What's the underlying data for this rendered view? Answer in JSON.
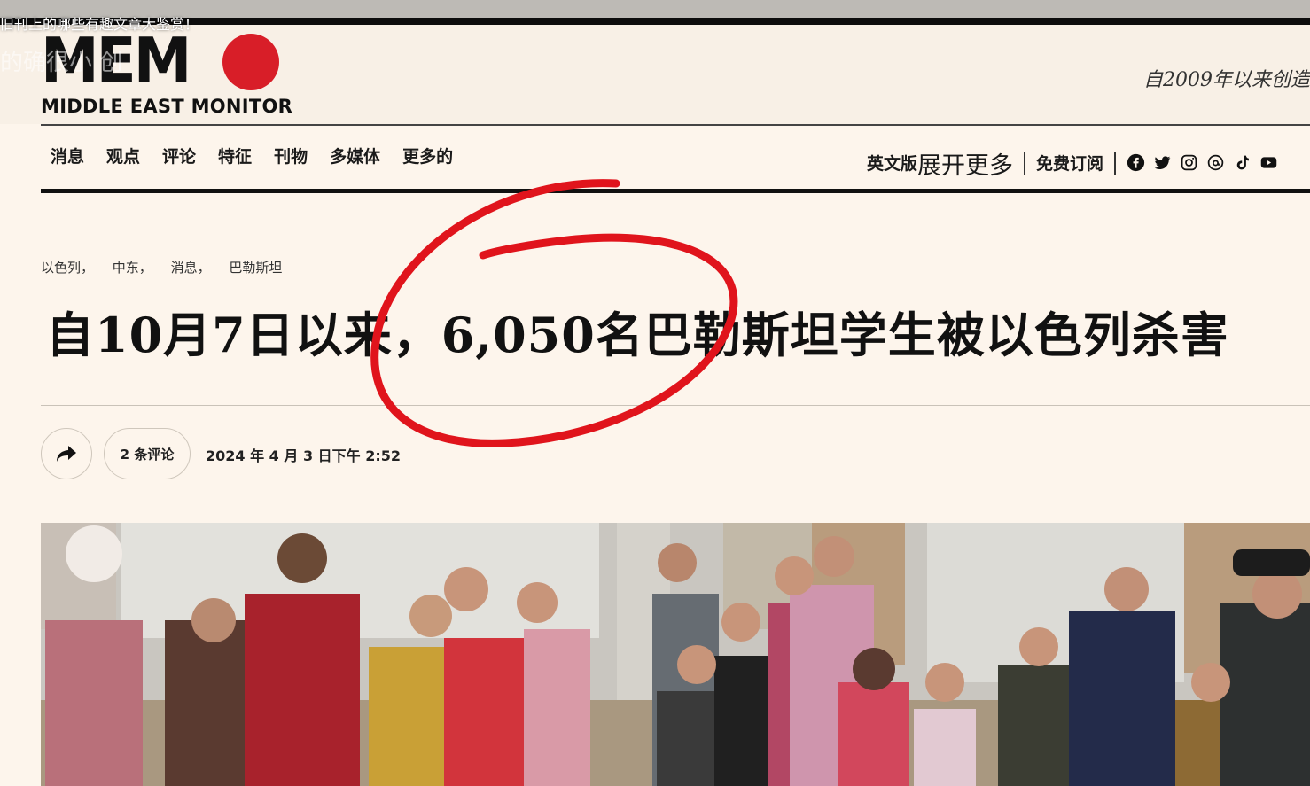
{
  "overlay": {
    "title": "旧刊上的哪些有趣文章大鉴赏！",
    "subtitle": "的确很小  创"
  },
  "brand": {
    "logo_text": "MEM",
    "logo_name": "MIDDLE EAST MONITOR",
    "tagline": "自2009年以来创造",
    "accent": "#d81e28"
  },
  "nav": {
    "items": [
      "消息",
      "观点",
      "评论",
      "特征",
      "刊物",
      "多媒体",
      "更多的"
    ],
    "english_edition": "英文版",
    "expand_more": "展开更多",
    "subscribe": "免费订阅",
    "socials": [
      "facebook-icon",
      "twitter-icon",
      "instagram-icon",
      "threads-icon",
      "tiktok-icon",
      "youtube-icon"
    ]
  },
  "article": {
    "tags": [
      "以色列，",
      "中东，",
      "消息，",
      "巴勒斯坦"
    ],
    "headline": "自10月7日以来，6,050名巴勒斯坦学生被以色列杀害",
    "comments": "2 条评论",
    "date": "2024 年 4 月 3 日下午 2:52",
    "photo_alt": "children-in-school-yard"
  },
  "annotation": {
    "color": "#e0141c"
  }
}
